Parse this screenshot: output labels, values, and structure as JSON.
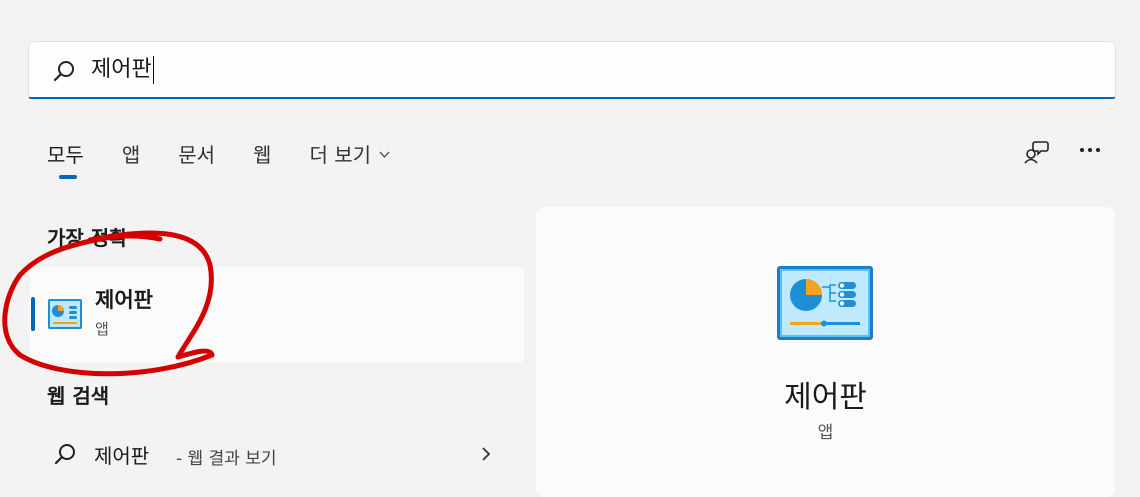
{
  "search": {
    "query": "제어판"
  },
  "tabs": [
    {
      "label": "모두"
    },
    {
      "label": "앱"
    },
    {
      "label": "문서"
    },
    {
      "label": "웹"
    },
    {
      "label": "더 보기"
    }
  ],
  "left": {
    "best_match_title": "가장 정확",
    "best_match": {
      "name": "제어판",
      "type": "앱"
    },
    "web_search_title": "웹 검색",
    "web_result": {
      "term": "제어판",
      "suffix": "- 웹 결과 보기"
    }
  },
  "detail": {
    "name": "제어판",
    "type": "앱"
  },
  "colors": {
    "accent": "#0067c0",
    "background": "#f3f3f3",
    "annotation": "#d40000",
    "icon_blue": "#29a8e8",
    "icon_orange": "#f5a31a"
  },
  "icons": {
    "search": "search-icon",
    "chat": "chat-feedback-icon",
    "more": "more-icon",
    "chevron_down": "chevron-down-icon",
    "chevron_right": "chevron-right-icon",
    "control_panel": "control-panel-icon"
  }
}
